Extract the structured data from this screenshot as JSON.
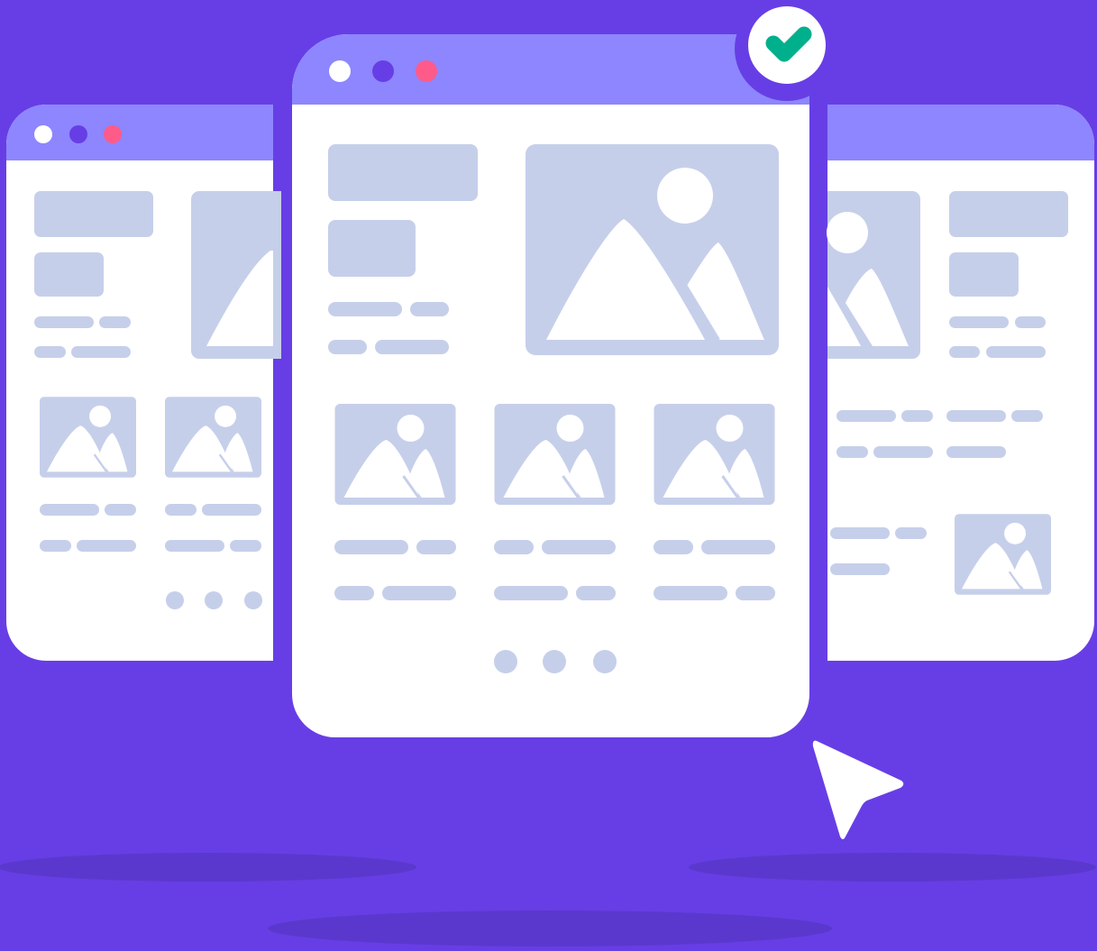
{
  "scene": {
    "description_type": "illustration",
    "background_color": "#673ee5",
    "header_color": "#8d86fe",
    "placeholder_color": "#c6cfea",
    "window_color": "#ffffff",
    "shadow_color": "#5b38cd"
  },
  "windows": [
    {
      "id": "left",
      "dots": [
        {
          "color": "#ffffff",
          "icon": "window-dot-white"
        },
        {
          "color": "#673ee5",
          "icon": "window-dot-purple"
        },
        {
          "color": "#fe5b8a",
          "icon": "window-dot-pink"
        }
      ],
      "pagination_dots": 3
    },
    {
      "id": "center",
      "selected": true,
      "dots": [
        {
          "color": "#ffffff",
          "icon": "window-dot-white"
        },
        {
          "color": "#673ee5",
          "icon": "window-dot-purple"
        },
        {
          "color": "#fe5b8a",
          "icon": "window-dot-pink"
        }
      ],
      "pagination_dots": 3
    },
    {
      "id": "right",
      "dots": []
    }
  ],
  "badge": {
    "icon": "check-icon",
    "check_color": "#00b08d"
  },
  "cursor": {
    "icon": "cursor-arrow-icon"
  }
}
